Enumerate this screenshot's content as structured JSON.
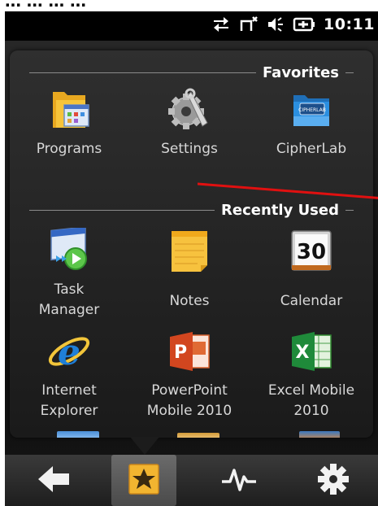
{
  "caption_fragment": "... ... ... ...",
  "status_bar": {
    "time": "10:11",
    "icons": [
      "data-transfer-icon",
      "no-signal-icon",
      "volume-icon",
      "battery-charging-icon"
    ]
  },
  "sections": [
    {
      "title": "Favorites",
      "items": [
        {
          "label": "Programs",
          "icon": "programs-folder-icon"
        },
        {
          "label": "Settings",
          "icon": "settings-gear-icon"
        },
        {
          "label": "CipherLab",
          "icon": "cipherlab-folder-icon"
        }
      ]
    },
    {
      "title": "Recently Used",
      "items": [
        {
          "label_lines": [
            "Task",
            "Manager"
          ],
          "icon": "task-manager-icon"
        },
        {
          "label": "Notes",
          "icon": "notes-icon"
        },
        {
          "label": "Calendar",
          "icon": "calendar-icon",
          "calendar_day": "30"
        },
        {
          "label_lines": [
            "Internet",
            "Explorer"
          ],
          "icon": "internet-explorer-icon"
        },
        {
          "label_lines": [
            "PowerPoint",
            "Mobile 2010"
          ],
          "icon": "powerpoint-icon"
        },
        {
          "label_lines": [
            "Excel Mobile",
            "2010"
          ],
          "icon": "excel-icon"
        }
      ]
    }
  ],
  "toolbar": {
    "buttons": [
      {
        "name": "back",
        "icon": "back-arrow-icon",
        "active": false
      },
      {
        "name": "favorites",
        "icon": "star-icon",
        "active": true
      },
      {
        "name": "activity",
        "icon": "pulse-icon",
        "active": false
      },
      {
        "name": "settings",
        "icon": "gear-icon",
        "active": false
      }
    ]
  },
  "colors": {
    "accent_red": "#e01010",
    "favorites_active": "#f2b530"
  }
}
